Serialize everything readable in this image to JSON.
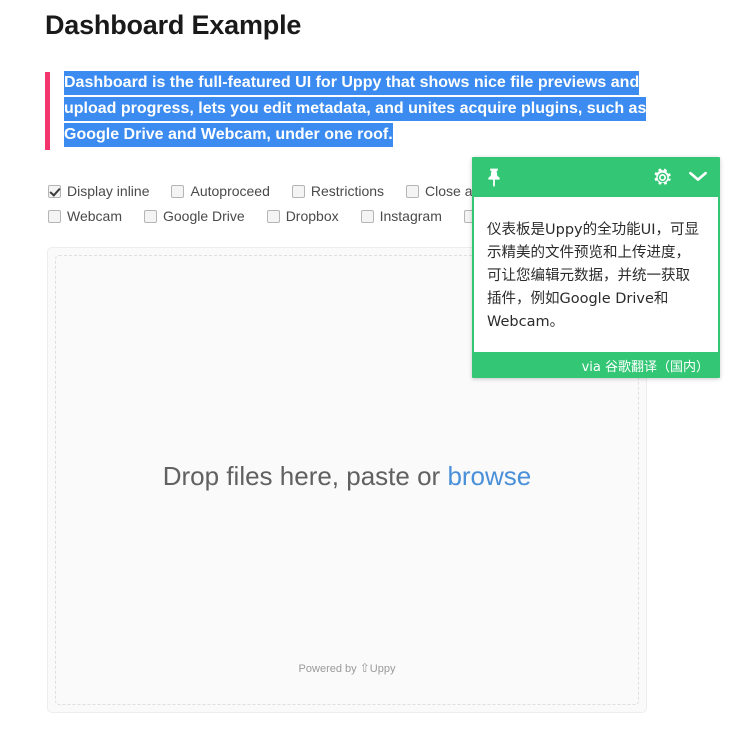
{
  "page": {
    "title": "Dashboard Example"
  },
  "blockquote": {
    "text": "Dashboard is the full-featured UI for Uppy that shows nice file previews and upload progress, lets you edit metadata, and unites acquire plugins, such as Google Drive and Webcam, under one roof.",
    "bar_color": "#f2356d",
    "selection_color": "#3b8bf0"
  },
  "options": {
    "row1": [
      {
        "label": "Display inline",
        "checked": true
      },
      {
        "label": "Autoproceed",
        "checked": false
      },
      {
        "label": "Restrictions",
        "checked": false
      },
      {
        "label": "Close a",
        "checked": false
      }
    ],
    "row2": [
      {
        "label": "Webcam",
        "checked": false
      },
      {
        "label": "Google Drive",
        "checked": false
      },
      {
        "label": "Dropbox",
        "checked": false
      },
      {
        "label": "Instagram",
        "checked": false
      },
      {
        "label": "",
        "checked": false
      }
    ]
  },
  "uppy": {
    "drop_text": "Drop files here, paste or ",
    "browse_label": "browse",
    "powered_by": "Powered by ",
    "powered_by_arrow": "⇧",
    "powered_by_brand": "Uppy",
    "browse_color": "#4a90d9"
  },
  "translate_popup": {
    "icons": {
      "pin": "pin-icon",
      "settings": "gear-icon",
      "collapse": "chevron-down-icon"
    },
    "translated_text": "仪表板是Uppy的全功能UI，可显示精美的文件预览和上传进度，可让您编辑元数据，并统一获取插件，例如Google Drive和Webcam。",
    "source_label": "via 谷歌翻译（国内）",
    "accent_color": "#33c775"
  }
}
